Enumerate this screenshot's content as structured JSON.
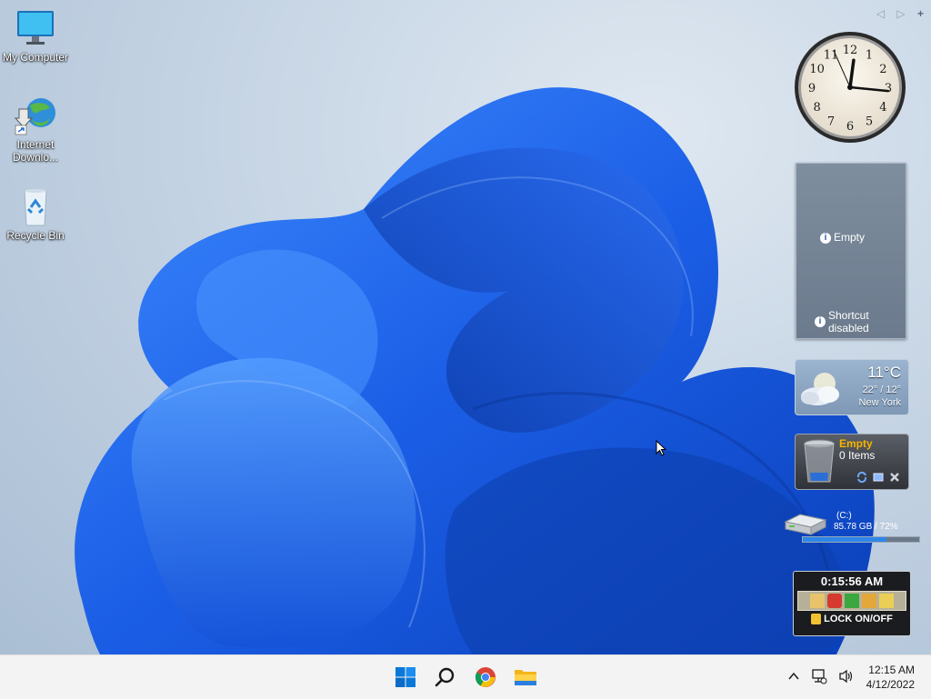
{
  "desktop_icons": [
    {
      "label": "My Computer",
      "icon": "monitor-icon"
    },
    {
      "label": "Internet Downlo...",
      "label_line1": "Internet",
      "label_line2": "Downlo...",
      "icon": "internet-download-manager-icon"
    },
    {
      "label": "Recycle Bin",
      "icon": "recycle-bin-icon"
    }
  ],
  "gadget_controls": {
    "prev": "◁",
    "next": "▷",
    "add": "+"
  },
  "clock_gadget": {
    "numbers": [
      "12",
      "1",
      "2",
      "3",
      "4",
      "5",
      "6",
      "7",
      "8",
      "9",
      "10",
      "11"
    ],
    "hour": 12,
    "minute": 15,
    "second": 56
  },
  "slideshow_gadget": {
    "status": "Empty",
    "note_line1": "Shortcut",
    "note_line2": "disabled"
  },
  "weather_gadget": {
    "temp": "11°C",
    "range": "22° / 12°",
    "city": "New York"
  },
  "recycle_gadget": {
    "status": "Empty",
    "items": "0 Items"
  },
  "drive_gadget": {
    "drive": "(C:)",
    "usage": "85.78 GB / 72%",
    "fill_percent": 72
  },
  "lock_gadget": {
    "time": "0:15:56 AM",
    "label": "LOCK ON/OFF"
  },
  "taskbar": {
    "apps": [
      "start-icon",
      "search-icon",
      "chrome-icon",
      "file-explorer-icon"
    ],
    "tray_chevron": "^",
    "time": "12:15 AM",
    "date": "4/12/2022"
  },
  "colors": {
    "accent": "#0067c0",
    "wallpaper_blue": "#1a5fe0",
    "taskbar": "#f3f3f3"
  }
}
